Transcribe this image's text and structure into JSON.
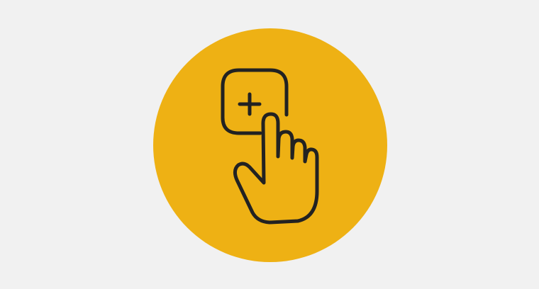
{
  "illustration": {
    "icon": "hand-tap-add-icon",
    "background_color": "#f1f1f1",
    "circle_color": "#eeb114",
    "stroke_color": "#222222"
  }
}
